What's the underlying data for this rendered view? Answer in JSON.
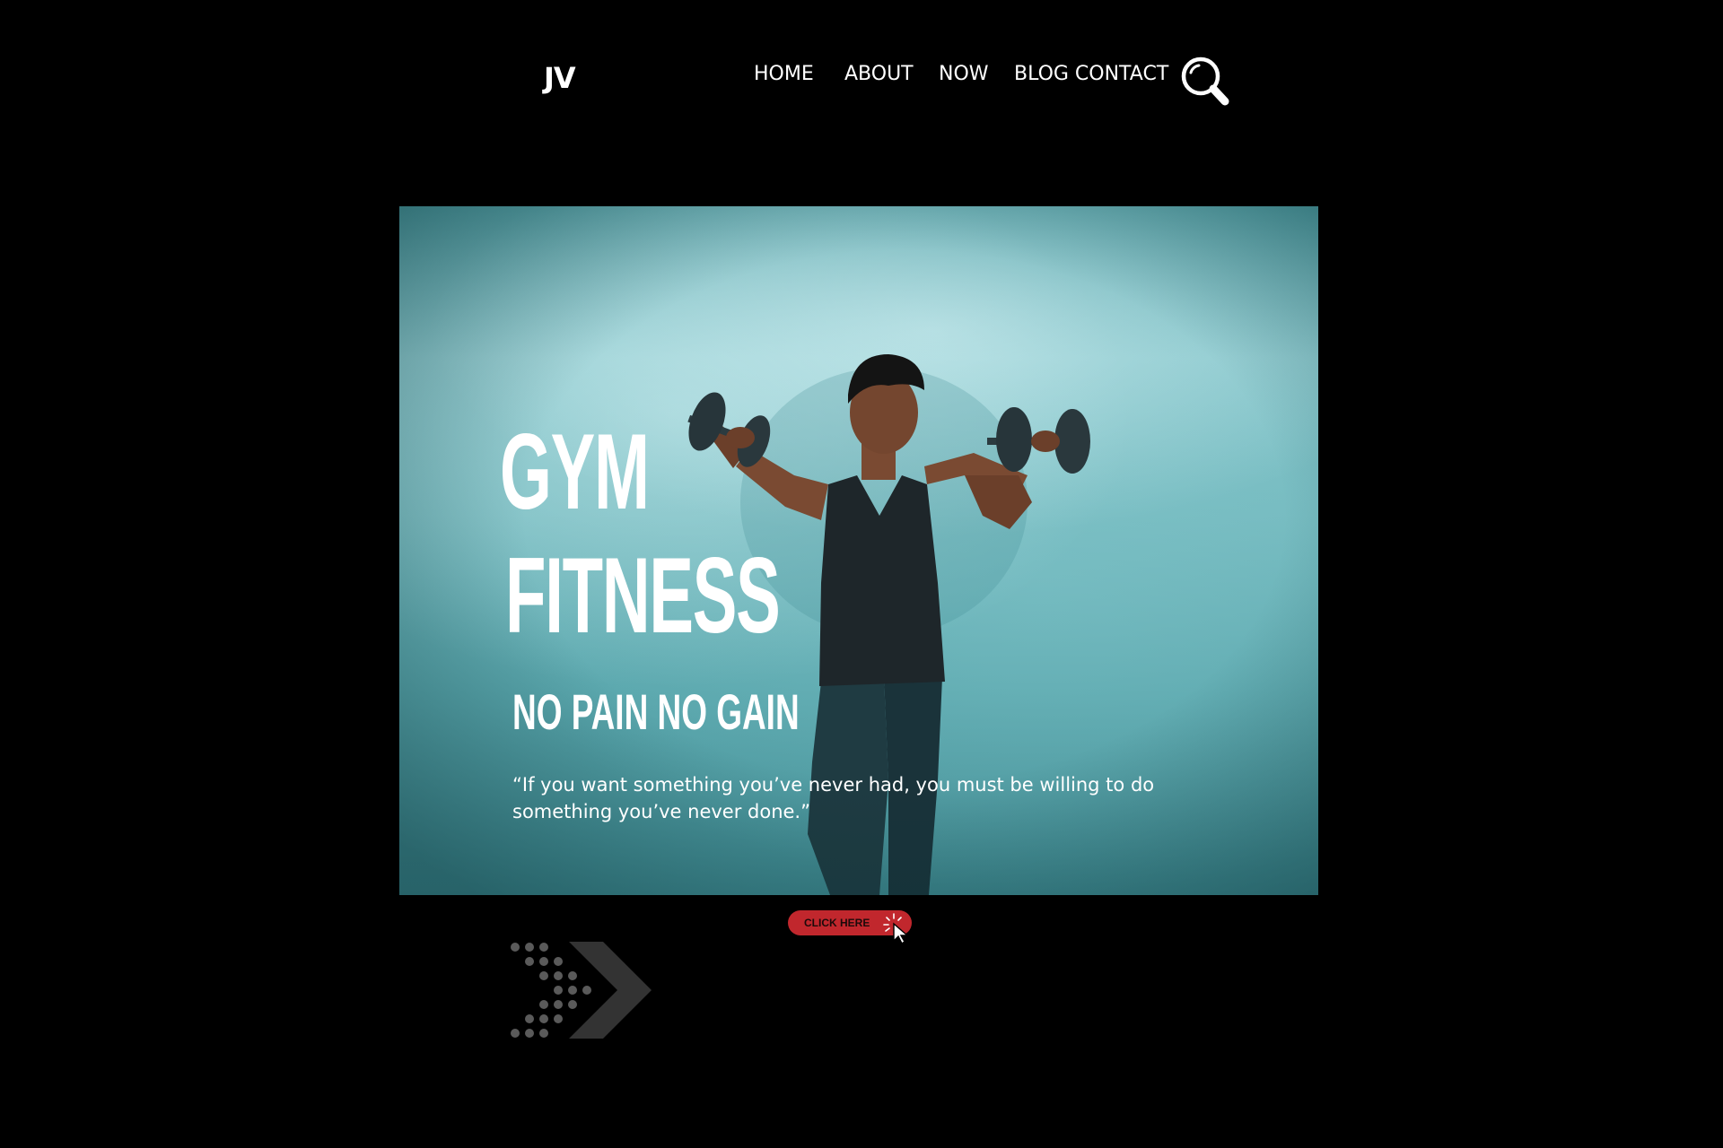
{
  "header": {
    "logo": "JV",
    "nav": [
      {
        "label": "HOME"
      },
      {
        "label": "ABOUT"
      },
      {
        "label": "NOW"
      },
      {
        "label": "BLOG CONTACT"
      }
    ],
    "search_icon": "search-icon"
  },
  "hero": {
    "title_line1": "GYM",
    "title_line2": "FITNESS",
    "tagline": "NO PAIN NO GAIN",
    "quote_line1": "“If you want something you’ve never had, you must be willing to do",
    "quote_line2": "something you’ve never done.”"
  },
  "cta": {
    "label": "CLICK HERE",
    "icon": "cursor-click-icon"
  },
  "decor": {
    "icon": "dotted-arrow-icon"
  },
  "colors": {
    "background": "#000000",
    "cta": "#c1272d",
    "hero_teal": "#73b9be",
    "text": "#ffffff"
  }
}
